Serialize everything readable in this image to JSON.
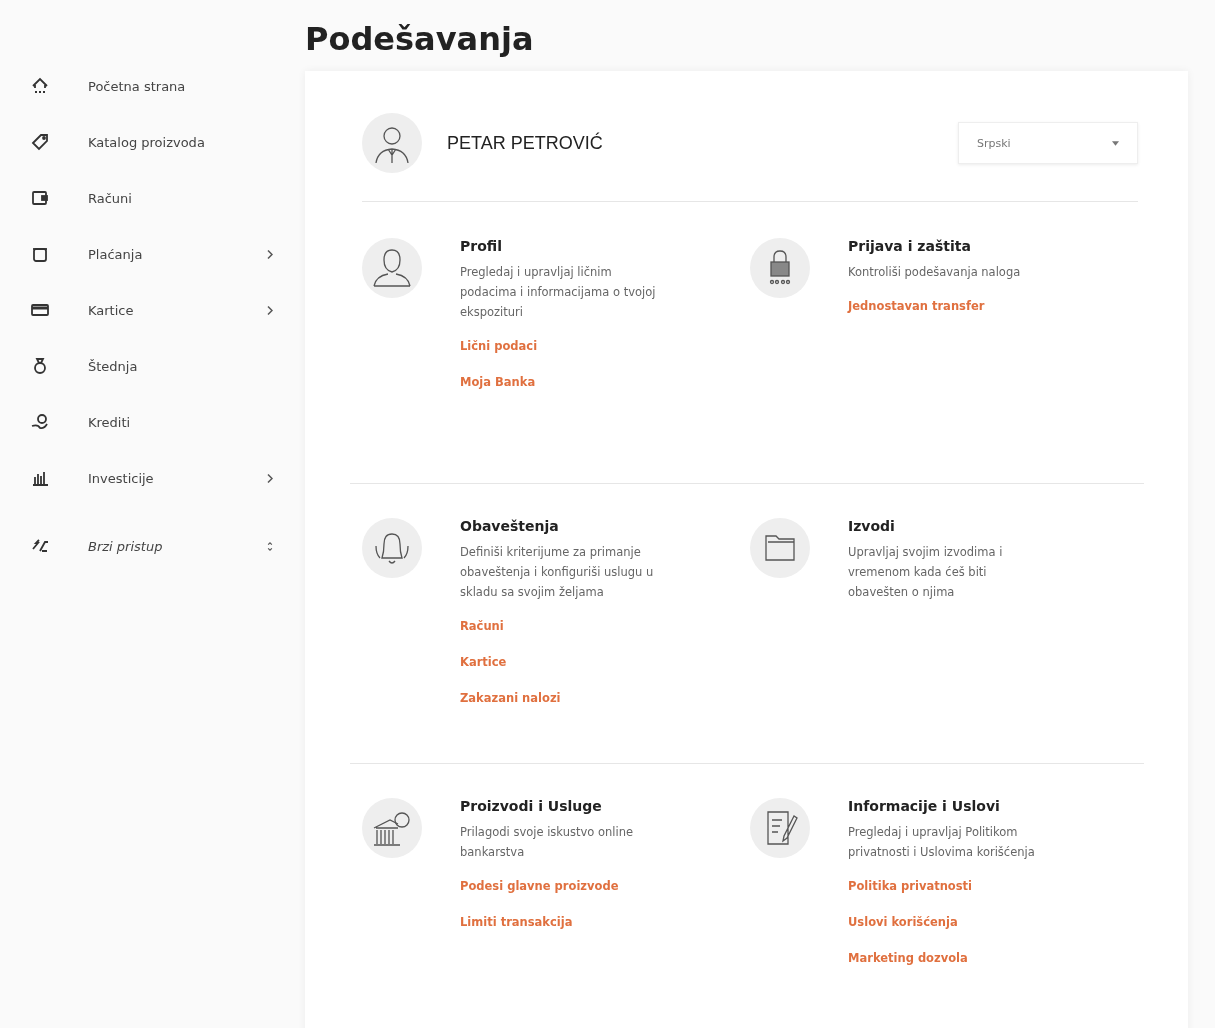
{
  "sidebar": {
    "items": [
      {
        "label": "Početna strana",
        "kind": "link"
      },
      {
        "label": "Katalog proizvoda",
        "kind": "link"
      },
      {
        "label": "Računi",
        "kind": "link"
      },
      {
        "label": "Plaćanja",
        "kind": "submenu"
      },
      {
        "label": "Kartice",
        "kind": "submenu"
      },
      {
        "label": "Štednja",
        "kind": "link"
      },
      {
        "label": "Krediti",
        "kind": "link"
      },
      {
        "label": "Investicije",
        "kind": "submenu"
      },
      {
        "label": "Brzi pristup",
        "kind": "expandable"
      }
    ]
  },
  "page_title": "Podešavanja",
  "user": {
    "name": "PETAR PETROVIĆ"
  },
  "language_select": {
    "value": "Srpski"
  },
  "sections": [
    {
      "title": "Profil",
      "description": "Pregledaj i upravljaj ličnim podacima i informacijama o tvojoj ekspozituri",
      "links": [
        "Lični podaci",
        "Moja Banka"
      ]
    },
    {
      "title": "Prijava i zaštita",
      "description": "Kontroliši podešavanja naloga",
      "links": [
        "Jednostavan transfer"
      ]
    },
    {
      "title": "Obaveštenja",
      "description": "Definiši kriterijume za primanje obaveštenja i konfiguriši uslugu u skladu sa svojim željama",
      "links": [
        "Računi",
        "Kartice",
        "Zakazani nalozi"
      ]
    },
    {
      "title": "Izvodi",
      "description": "Upravljaj svojim izvodima i vremenom kada ćeš biti obavešten o njima"
    },
    {
      "title": "Proizvodi i Usluge",
      "description": "Prilagodi svoje iskustvo online bankarstva",
      "links": [
        "Podesi glavne proizvode",
        "Limiti transakcija"
      ]
    },
    {
      "title": "Informacije i Uslovi",
      "description": "Pregledaj i upravljaj Politikom privatnosti i Uslovima korišćenja",
      "links": [
        "Politika privatnosti",
        "Uslovi korišćenja",
        "Marketing dozvola"
      ]
    }
  ]
}
